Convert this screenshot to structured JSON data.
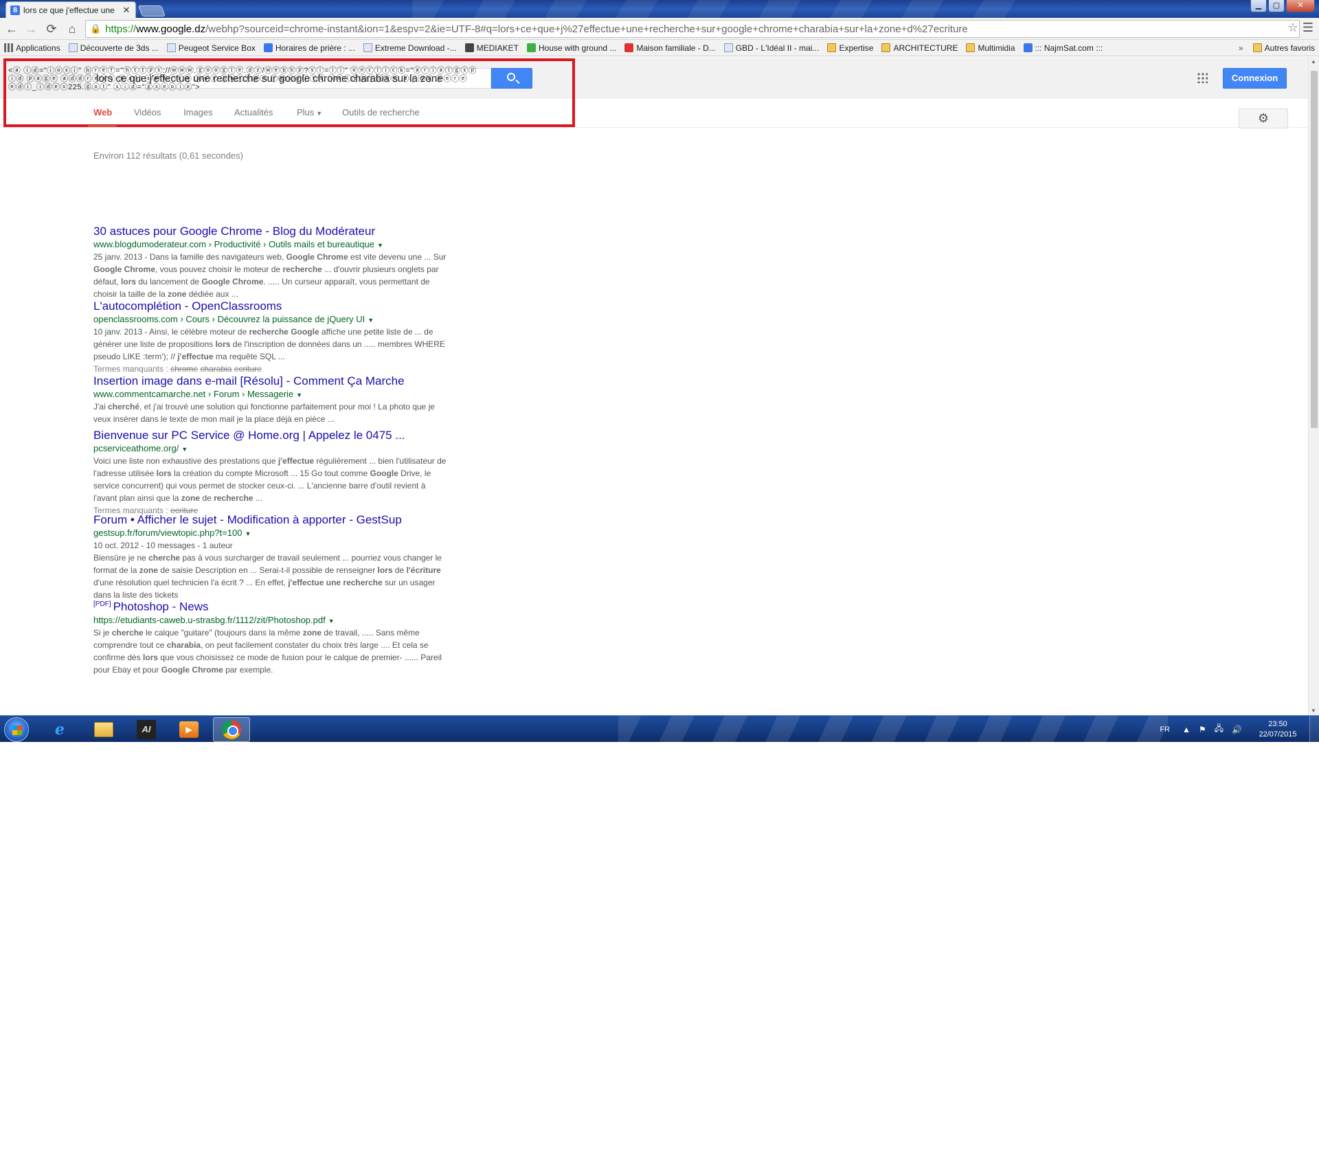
{
  "window": {
    "tab_title": "lors ce que j'effectue une",
    "tab_close": "✕",
    "tab_favicon": "8",
    "controls": {
      "minimize": "▁",
      "maximize": "▢",
      "close": "✕"
    }
  },
  "toolbar": {
    "back": "←",
    "forward": "→",
    "reload": "⟳",
    "home": "⌂",
    "url_scheme": "https://",
    "url_host": "www.google.dz",
    "url_path": "/webhp?sourceid=chrome-instant&ion=1&espv=2&ie=UTF-8#q=lors+ce+que+j%27effectue+une+recherche+sur+google+chrome+charabia+sur+la+zone+d%27ecriture",
    "star": "☆",
    "menu": "☰"
  },
  "bookmarks": {
    "items": [
      {
        "label": "Applications",
        "icon": "grid"
      },
      {
        "label": "Découverte de 3ds ...",
        "icon": "page"
      },
      {
        "label": "Peugeot Service Box",
        "icon": "page"
      },
      {
        "label": "Horaires de prière : ...",
        "icon": "blue"
      },
      {
        "label": "Extreme Download -...",
        "icon": "page"
      },
      {
        "label": "MEDIAKET",
        "icon": "dark"
      },
      {
        "label": "House with ground ...",
        "icon": "green"
      },
      {
        "label": "Maison familiale - D...",
        "icon": "red"
      },
      {
        "label": "GBD - L'Idéal II - mai...",
        "icon": "page"
      },
      {
        "label": "Expertise",
        "icon": "folder"
      },
      {
        "label": "ARCHITECTURE",
        "icon": "folder"
      },
      {
        "label": "Multimidia",
        "icon": "folder"
      },
      {
        "label": "::: NajmSat.com :::",
        "icon": "blue"
      }
    ],
    "more": "»",
    "other": "Autres favoris"
  },
  "search": {
    "query": "lors ce que j'effectue une recherche sur google chrome charabia sur la zone",
    "garbled_overlay": "<ⓐ ⓘⓓ=\"ⓘⓞⓢⓘ\" ⓗⓡⓔⓕ=\"ⓗⓣⓣⓟⓢ://ⓦⓦⓦ.ⓖⓞⓞⓖⓛⓔ.ⓓⓩ/ⓦⓔⓑⓗⓟ?ⓢⓘ=ⓘⓘ\" ⓞⓝⓒⓛⓘⓒⓚ=\"ⓐⓡⓘⓐⓛⓖⓢⓟ\nⓘⓓ ⓟⓐⓖⓔ ⓐⓓⓓⓡⓔⓢⓢ ⓑⓐⓡ ⓢⓔⓐⓡⓒⓗ ⓑⓞⓧ ⓑⓤⓣⓣⓞⓝ ⓡⓔⓢⓤⓛⓣⓢ ⓢⓔⓛⓔⓒⓣⓘⓞⓝ ⓐⓡⓔⓐ ⓗⓔⓡⓔ\nⓔⓓⓘ_ⓘⓓⓔⓢ225.ⓖⓞⓣ\" ⓢⓘⓓ=\"ⓖⓢⓔⓞⓘⓔ\">",
    "apps_icon": "apps-grid-icon",
    "signin_label": "Connexion"
  },
  "nav": {
    "tabs": [
      {
        "label": "Web",
        "active": true
      },
      {
        "label": "Vidéos",
        "active": false
      },
      {
        "label": "Images",
        "active": false
      },
      {
        "label": "Actualités",
        "active": false
      },
      {
        "label": "Plus",
        "active": false
      },
      {
        "label": "Outils de recherche",
        "active": false
      }
    ],
    "plus_caret": "▼",
    "settings_icon": "⚙"
  },
  "stats": "Environ 112 résultats (0,61 secondes)",
  "results": [
    {
      "title": "30 astuces pour Google Chrome - Blog du Modérateur",
      "url": "www.blogdumoderateur.com › Productivité › Outils mails et bureautique",
      "snippet_html": "25 janv. 2013 - Dans la famille des navigateurs web, <b>Google Chrome</b> est vite devenu une ... Sur <b>Google Chrome</b>, vous pouvez choisir le moteur de <b>recherche</b> ... d'ouvrir plusieurs onglets par défaut, <b>lors</b> du lancement de <b>Google Chrome</b>. ..... Un curseur apparaît, vous permettant de choisir la taille de la <b>zone</b> dédiée aux  ..."
    },
    {
      "title": "L'autocomplétion - OpenClassrooms",
      "url": "openclassrooms.com › Cours › Découvrez la puissance de jQuery UI",
      "snippet_html": "10 janv. 2013 - Ainsi, le célèbre moteur de <b>recherche Google</b> affiche une petite liste de ... de générer une liste de propositions <b>lors</b> de l'inscription de données dans un ..... membres WHERE pseudo LIKE :term'); // <b>j'effectue</b> ma requête SQL  ...<br><span class=\"missing-line\">Termes manquants : <span class=\"strike\">chrome</span> <span class=\"strike\">charabia</span> <span class=\"strike\">ecriture</span></span>"
    },
    {
      "title": "Insertion image dans e-mail [Résolu] - Comment Ça Marche",
      "url": "www.commentcamarche.net › Forum › Messagerie",
      "snippet_html": "J'ai <b>cherché</b>, et j'ai trouvé une solution qui fonctionne parfaitement pour moi ! La photo que je veux insérer dans le texte de mon mail je la place déjà en pièce  ..."
    },
    {
      "title": "Bienvenue sur PC Service @ Home.org | Appelez le 0475 ...",
      "url": "pcserviceathome.org/",
      "snippet_html": "Voici une liste non exhaustive des prestations que <b>j'effectue</b> régulièrement ... bien l'utilisateur de l'adresse utilisée <b>lors</b> la création du compte Microsoft ... 15 Go tout comme <b>Google</b> Drive, le service concurrent) qui vous permet de stocker ceux-ci. ... L'ancienne barre d'outil revient à l'avant plan ainsi que la <b>zone</b> de <b>recherche</b> ...<br><span class=\"missing-line\">Termes manquants : <span class=\"strike\">ecriture</span></span>"
    },
    {
      "title": "Forum • Afficher le sujet - Modification à apporter - GestSup",
      "url": "gestsup.fr/forum/viewtopic.php?t=100",
      "snippet_html": "10 oct. 2012 - 10 messages - 1 auteur<br>Biensûre je ne <b>cherche</b> pas à vous surcharger de travail seulement ... pourriez vous changer le format de la <b>zone</b> de saisie Description en ... Serai-t-il possible de renseigner <b>lors</b> de <b>l'écriture</b> d'une résolution quel technicien l'a écrit ? ... En effet, <b>j'effectue une recherche</b> sur un usager dans la liste des tickets"
    },
    {
      "title": "Photoshop - News",
      "pdf_tag": "[PDF]",
      "url": "https://etudiants-caweb.u-strasbg.fr/1112/zit/Photoshop.pdf",
      "snippet_html": "Si je <b>cherche</b> le calque \"guitare\" (toujours dans la même <b>zone</b> de travail, ..... Sans même comprendre tout ce <b>charabia</b>, on peut facilement constater du choix très large .... Et cela se confirme dès <b>lors</b> que vous choisissez ce mode de fusion pour le calque de premier- ...... Pareil pour Ebay et pour <b>Google Chrome</b> par exemple."
    }
  ],
  "result_caret": "▼",
  "taskbar": {
    "language": "FR",
    "time": "23:50",
    "date": "22/07/2015",
    "tray_up": "▲",
    "tray_flag": "⚑",
    "tray_network": "🖧",
    "tray_volume": "🔊",
    "ie_glyph": "e",
    "ai_glyph": "AI",
    "media_glyph": "▶"
  },
  "colors": {
    "highlight_border": "#d8171f",
    "link": "#1a0dab",
    "url_green": "#006621",
    "google_blue": "#4285f4",
    "active_tab_red": "#dd4b39"
  }
}
